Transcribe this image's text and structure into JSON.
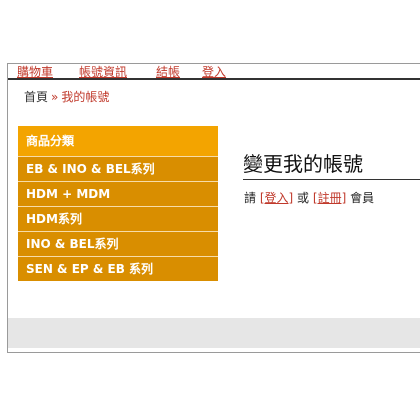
{
  "topnav": {
    "items": [
      {
        "label": "購物車"
      },
      {
        "label": "帳號資訊"
      },
      {
        "label": "結帳"
      },
      {
        "label": "登入"
      }
    ]
  },
  "breadcrumb": {
    "home": "首頁",
    "separator": "»",
    "current": "我的帳號"
  },
  "sidebar": {
    "heading": "商品分類",
    "items": [
      {
        "label": "EB & INO & BEL系列"
      },
      {
        "label": "HDM + MDM"
      },
      {
        "label": "HDM系列"
      },
      {
        "label": "INO & BEL系列"
      },
      {
        "label": "SEN & EP & EB 系列"
      }
    ]
  },
  "main": {
    "title": "變更我的帳號",
    "msg_prefix": "請",
    "login_link": "[登入]",
    "msg_or": "或",
    "register_link": "[註冊]",
    "msg_suffix": "會員"
  },
  "colors": {
    "accent": "#f3a400",
    "menu_item": "#d98e00",
    "link": "#c0392b"
  }
}
